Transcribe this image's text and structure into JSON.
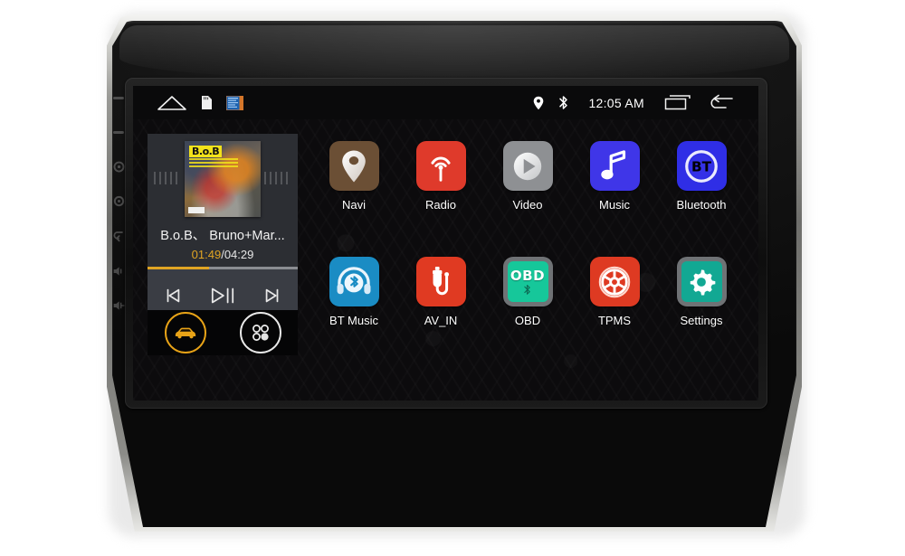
{
  "device": {
    "name": "car-head-unit",
    "bezel_color": "#101010",
    "trim_color": "#9a9a96"
  },
  "statusbar": {
    "home_icon": "home-icon",
    "sd_icon": "sd-card-icon",
    "usb_icon": "usb-storage-icon",
    "gps_icon": "location-pin-icon",
    "bluetooth_icon": "bluetooth-icon",
    "clock": "12:05 AM",
    "recents_icon": "recent-apps-icon",
    "back_icon": "back-arrow-icon"
  },
  "media_widget": {
    "album_logo": "B.o.B",
    "track_title": "B.o.B、 Bruno+Mar...",
    "time_current": "01:49",
    "time_separator": "/",
    "time_total": "04:29",
    "progress_percent": 41,
    "progress_color": "#e0a423",
    "controls": {
      "previous": "previous-track-icon",
      "playpause": "play-pause-icon",
      "next": "next-track-icon"
    },
    "dock": {
      "car_button": "car-mode-icon",
      "apps_button": "all-apps-icon",
      "car_accent": "#e8a317"
    }
  },
  "apps": [
    {
      "label": "Navi",
      "icon": "map-pin-icon",
      "tile_color": "#6b4f35"
    },
    {
      "label": "Radio",
      "icon": "radio-waves-icon",
      "tile_color": "#df3a2b"
    },
    {
      "label": "Video",
      "icon": "play-circle-icon",
      "tile_color": "#8e9093"
    },
    {
      "label": "Music",
      "icon": "music-note-icon",
      "tile_color": "#3f36e8"
    },
    {
      "label": "Bluetooth",
      "icon": "bt-badge-icon",
      "tile_color": "#2f2ee6"
    },
    {
      "label": "BT Music",
      "icon": "headphones-bt-icon",
      "tile_color": "#1a8cc4"
    },
    {
      "label": "AV_IN",
      "icon": "av-plug-icon",
      "tile_color": "#e03a22"
    },
    {
      "label": "OBD",
      "icon": "obd-icon",
      "tile_color": "#6f7275",
      "inner_color": "#16c79a",
      "inner_text": "OBD"
    },
    {
      "label": "TPMS",
      "icon": "tire-pressure-icon",
      "tile_color": "#de3a22"
    },
    {
      "label": "Settings",
      "icon": "gear-icon",
      "tile_color": "#6f7275",
      "inner_color": "#12a893"
    }
  ],
  "hardkeys": [
    {
      "name": "hardkey-mute",
      "icon": "dash-icon"
    },
    {
      "name": "hardkey-mode",
      "icon": "dash-icon"
    },
    {
      "name": "hardkey-power",
      "icon": "power-icon"
    },
    {
      "name": "hardkey-home",
      "icon": "home-key-icon"
    },
    {
      "name": "hardkey-back",
      "icon": "return-key-icon"
    },
    {
      "name": "hardkey-vol-down",
      "icon": "volume-down-icon"
    },
    {
      "name": "hardkey-vol-up",
      "icon": "volume-up-icon"
    }
  ]
}
